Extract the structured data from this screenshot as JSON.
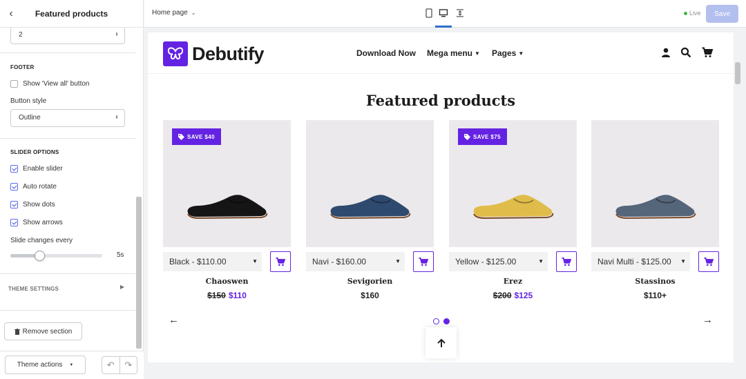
{
  "sidebar": {
    "back_label": "‹",
    "title": "Featured products",
    "rows_value": "2",
    "footer_heading": "FOOTER",
    "show_view_all_label": "Show 'View all' button",
    "show_view_all_checked": false,
    "button_style_label": "Button style",
    "button_style_value": "Outline",
    "slider_options_heading": "SLIDER OPTIONS",
    "options": [
      {
        "label": "Enable slider",
        "checked": true
      },
      {
        "label": "Auto rotate",
        "checked": true
      },
      {
        "label": "Show dots",
        "checked": true
      },
      {
        "label": "Show arrows",
        "checked": true
      }
    ],
    "slide_changes_label": "Slide changes every",
    "slide_changes_value": "5s",
    "slide_changes_level": 0.3,
    "theme_settings_label": "THEME SETTINGS",
    "remove_section_label": "Remove section",
    "theme_actions_label": "Theme actions"
  },
  "topbar": {
    "page_label": "Home page",
    "live_label": "Live",
    "save_label": "Save",
    "active_device": "desktop"
  },
  "store": {
    "brand": "Debutify",
    "nav": [
      {
        "label": "Download Now",
        "dropdown": false
      },
      {
        "label": "Mega menu",
        "dropdown": true
      },
      {
        "label": "Pages",
        "dropdown": true
      }
    ],
    "section_title": "Featured products",
    "accent_color": "#6423e3",
    "products": [
      {
        "badge": "SAVE $40",
        "variant": "Black - $110.00",
        "name": "Chaoswen",
        "old_price": "$150",
        "price": "$110",
        "shoe_color": "#151515"
      },
      {
        "badge": "",
        "variant": "Navi - $160.00",
        "name": "Sevigorien",
        "old_price": "",
        "price": "$160",
        "shoe_color": "#2e4a6e"
      },
      {
        "badge": "SAVE $75",
        "variant": "Yellow - $125.00",
        "name": "Erez",
        "old_price": "$200",
        "price": "$125",
        "shoe_color": "#e0bd4a"
      },
      {
        "badge": "",
        "variant": "Navi Multi - $125.00",
        "name": "Stassinos",
        "old_price": "",
        "price": "$110+",
        "shoe_color": "#55657a"
      }
    ],
    "slider_dots": 2,
    "active_dot": 2
  }
}
